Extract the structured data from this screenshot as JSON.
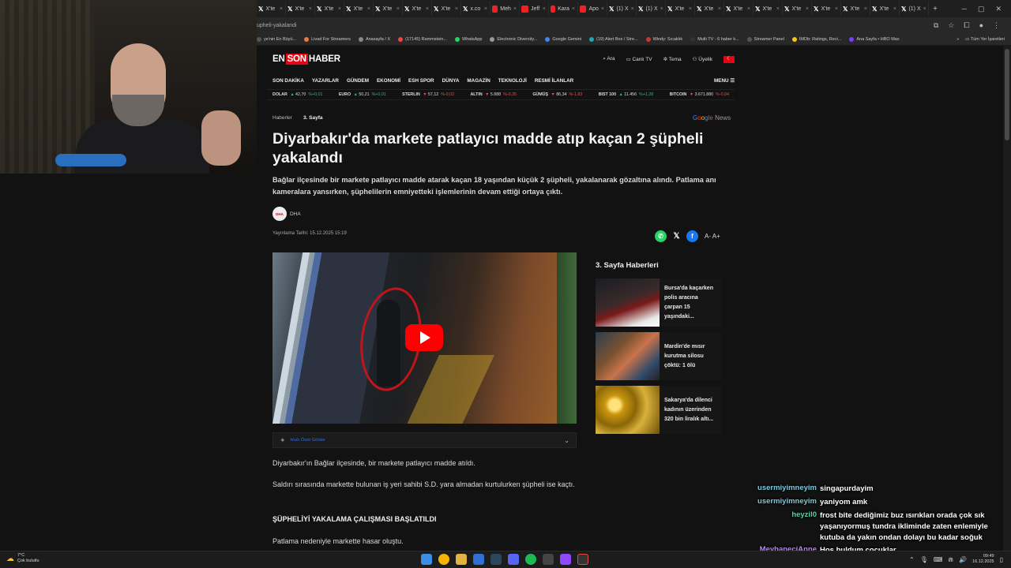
{
  "browser": {
    "tabs": [
      {
        "label": "X'te",
        "icon": "x-icon"
      },
      {
        "label": "X'te",
        "icon": "x-icon"
      },
      {
        "label": "X'te",
        "icon": "x-icon"
      },
      {
        "label": "X'te",
        "icon": "x-icon"
      },
      {
        "label": "X'te",
        "icon": "x-icon"
      },
      {
        "label": "X'te",
        "icon": "x-icon"
      },
      {
        "label": "X'te",
        "icon": "x-icon"
      },
      {
        "label": "x.co",
        "icon": "x-icon"
      },
      {
        "label": "Meh",
        "icon": "red-icon"
      },
      {
        "label": "Jeff",
        "icon": "red-icon"
      },
      {
        "label": "Kara",
        "icon": "red-icon"
      },
      {
        "label": "Apo",
        "icon": "red-icon"
      },
      {
        "label": "(1) X",
        "icon": "x-icon"
      },
      {
        "label": "(1) X",
        "icon": "x-icon"
      },
      {
        "label": "X'te",
        "icon": "x-icon"
      },
      {
        "label": "X'te",
        "icon": "x-icon"
      },
      {
        "label": "X'te",
        "icon": "x-icon"
      },
      {
        "label": "X'te",
        "icon": "x-icon"
      },
      {
        "label": "X'te",
        "icon": "x-icon"
      },
      {
        "label": "X'te",
        "icon": "x-icon"
      },
      {
        "label": "X'te",
        "icon": "x-icon"
      },
      {
        "label": "X'te",
        "icon": "x-icon"
      },
      {
        "label": "(1) X",
        "icon": "x-icon"
      }
    ],
    "new_tab": "+",
    "url": "upheli-yakalandi",
    "bookmarks": [
      "ye'nin En Büyü...",
      "Livad For Streamers",
      "Anasayfa / X",
      "(17145) Rammstein...",
      "WhatsApp",
      "Electronic Diversity...",
      "Google Gemini",
      "(19) Alert Box / Stre...",
      "Windy: Sıcaklık",
      "Multi TV - 6 haber k...",
      "Streamer Panel",
      "IMDb: Ratings, Revi...",
      "Ana Sayfa • HBO Max"
    ],
    "bookmarks_more": "»",
    "all_bookmarks": "Tüm Yer İşaretleri"
  },
  "site": {
    "logo_en": "EN",
    "logo_son": "SON",
    "logo_haber": "HABER",
    "actions": [
      "Ara",
      "Canlı TV",
      "Tema",
      "Üyelik"
    ],
    "nav": [
      "SON DAKİKA",
      "YAZARLAR",
      "GÜNDEM",
      "EKONOMİ",
      "ESH SPOR",
      "DÜNYA",
      "MAGAZİN",
      "TEKNOLOJİ",
      "RESMİ İLANLAR"
    ],
    "menu": "MENU",
    "ticker": [
      {
        "name": "DOLAR",
        "value": "42,70",
        "change": "%+0,01",
        "dir": "up"
      },
      {
        "name": "EURO",
        "value": "50,21",
        "change": "%+0,01",
        "dir": "up"
      },
      {
        "name": "STERLIN",
        "value": "57,12",
        "change": "%-0,02",
        "dir": "down"
      },
      {
        "name": "ALTIN",
        "value": "5.888",
        "change": "%-0,35",
        "dir": "down"
      },
      {
        "name": "GÜMÜŞ",
        "value": "86,34",
        "change": "%-1,83",
        "dir": "down"
      },
      {
        "name": "BIST 100",
        "value": "11.456",
        "change": "%+1,28",
        "dir": "up"
      },
      {
        "name": "BITCOIN",
        "value": "3.671.880",
        "change": "%-0,04",
        "dir": "down"
      }
    ]
  },
  "article": {
    "breadcrumb": [
      "Haberler",
      "3. Sayfa"
    ],
    "google_news": "Google News",
    "title": "Diyarbakır'da markete patlayıcı madde atıp kaçan 2 şüpheli yakalandı",
    "summary": "Bağlar ilçesinde bir markete patlayıcı madde atarak kaçan 18 yaşından küçük 2 şüpheli, yakalanarak gözaltına alındı. Patlama anı kameralara yansırken, şüphelilerin emniyetteki işlemlerinin devam ettiği ortaya çıktı.",
    "source_badge": "DHA",
    "source": "DHA",
    "published": "Yayınlama Tarihi: 15.12.2025 15:19",
    "font_controls": "A-  A+",
    "ai_summary": "Hızlı Özet Göster",
    "p1": "Diyarbakır'ın Bağlar ilçesinde, bir markete patlayıcı madde atıldı.",
    "p2": "Saldırı sırasında markette bulunan iş yeri sahibi S.D. yara almadan kurtulurken şüpheli ise kaçtı.",
    "h1": "ŞÜPHELİYİ YAKALAMA ÇALIŞMASI BAŞLATILDI",
    "p3": "Patlama nedeniyle markette hasar oluştu."
  },
  "sidebar": {
    "title": "3. Sayfa Haberleri",
    "items": [
      {
        "text": "Bursa'da kaçarken polis aracına çarpan 15 yaşındaki..."
      },
      {
        "text": "Mardin'de mısır kurutma silosu çöktü: 1 ölü"
      },
      {
        "text": "Sakarya'da dilenci kadının üzerinden 320 bin liralık altı..."
      }
    ]
  },
  "chat": [
    {
      "user": "usermiyimneyim",
      "msg": "singapurdayim"
    },
    {
      "user": "usermiyimneyim",
      "msg": "yaniyom amk"
    },
    {
      "user": "heyzil0",
      "msg": "frost bite dediğimiz buz ısırıkları orada çok sık yaşanıyormuş tundra ikliminde zaten enlemiyle kutuba da yakın ondan dolayı bu kadar soğuk"
    },
    {
      "user": "MeyhaneciAnne",
      "msg": "Hoş buldum çocuklar"
    }
  ],
  "taskbar": {
    "temp": "7°C",
    "weather": "Çok bulutlu",
    "time": "09:49",
    "date": "16.12.2025"
  }
}
